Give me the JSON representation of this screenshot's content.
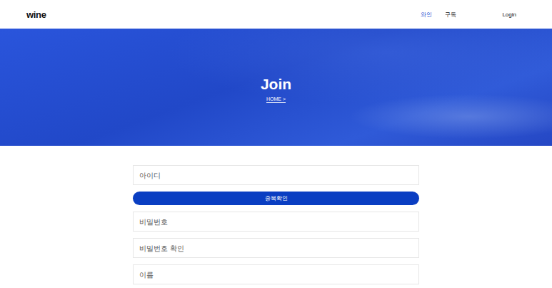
{
  "header": {
    "logo": "wine",
    "nav": [
      {
        "label": "와인",
        "selected": true
      },
      {
        "label": "구독",
        "selected": false
      }
    ],
    "login": "Login"
  },
  "hero": {
    "title": "Join",
    "breadcrumb": "HOME >"
  },
  "form": {
    "fields": [
      {
        "placeholder": "아이디",
        "kind": "text"
      },
      {
        "placeholder": "비밀번호",
        "kind": "password"
      },
      {
        "placeholder": "비밀번호 확인",
        "kind": "password"
      },
      {
        "placeholder": "이름",
        "kind": "text"
      }
    ],
    "check_button": "중복확인"
  }
}
